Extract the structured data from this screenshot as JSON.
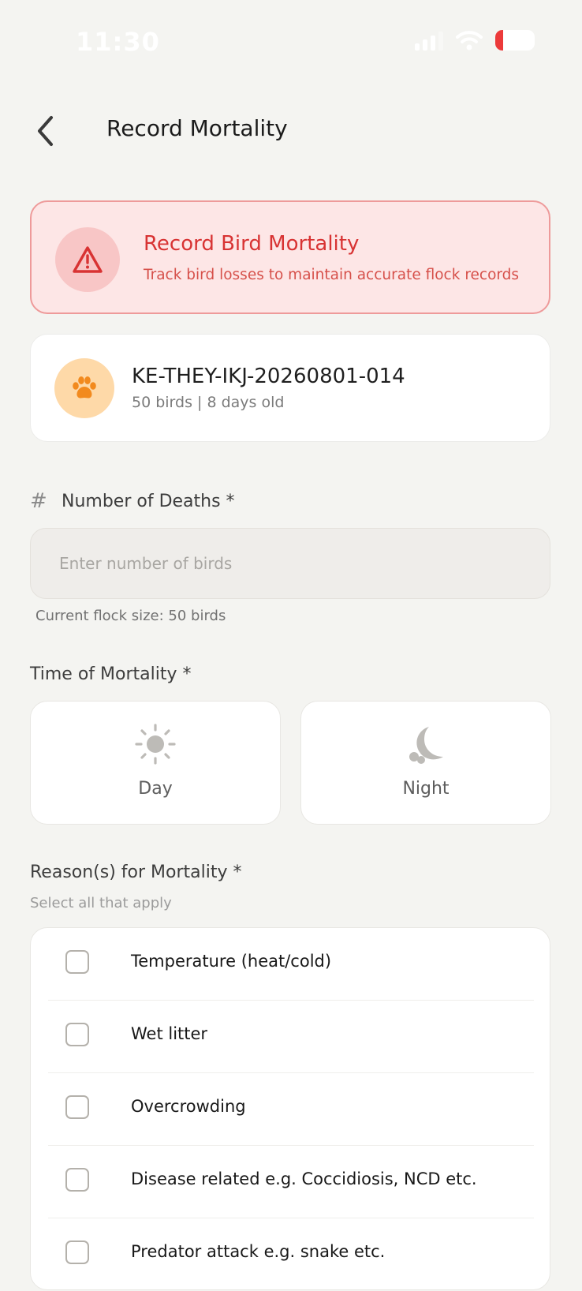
{
  "status_bar": {
    "time": "11:30",
    "battery_level": "10"
  },
  "header": {
    "title": "Record Mortality"
  },
  "alert": {
    "title": "Record Bird Mortality",
    "subtitle": "Track bird losses to maintain accurate flock records",
    "icon": "warning-triangle-icon",
    "accent_color": "#d83333"
  },
  "flock": {
    "id": "KE-THEY-IKJ-20260801-014",
    "meta": "50 birds | 8 days old",
    "icon": "paw-icon",
    "icon_color": "#f28a1e"
  },
  "deaths_field": {
    "label": "Number of Deaths *",
    "placeholder": "Enter number of birds",
    "value": "",
    "helper": "Current flock size: 50 birds"
  },
  "time_of_mortality": {
    "label": "Time of Mortality *",
    "options": [
      {
        "label": "Day",
        "icon": "sun-icon",
        "selected": false
      },
      {
        "label": "Night",
        "icon": "moon-icon",
        "selected": false
      }
    ]
  },
  "reasons": {
    "label": "Reason(s) for Mortality *",
    "hint": "Select all that apply",
    "items": [
      {
        "label": "Temperature (heat/cold)",
        "checked": false
      },
      {
        "label": "Wet litter",
        "checked": false
      },
      {
        "label": "Overcrowding",
        "checked": false
      },
      {
        "label": "Disease related e.g. Coccidiosis, NCD etc.",
        "checked": false
      },
      {
        "label": "Predator attack e.g. snake etc.",
        "checked": false
      }
    ]
  }
}
